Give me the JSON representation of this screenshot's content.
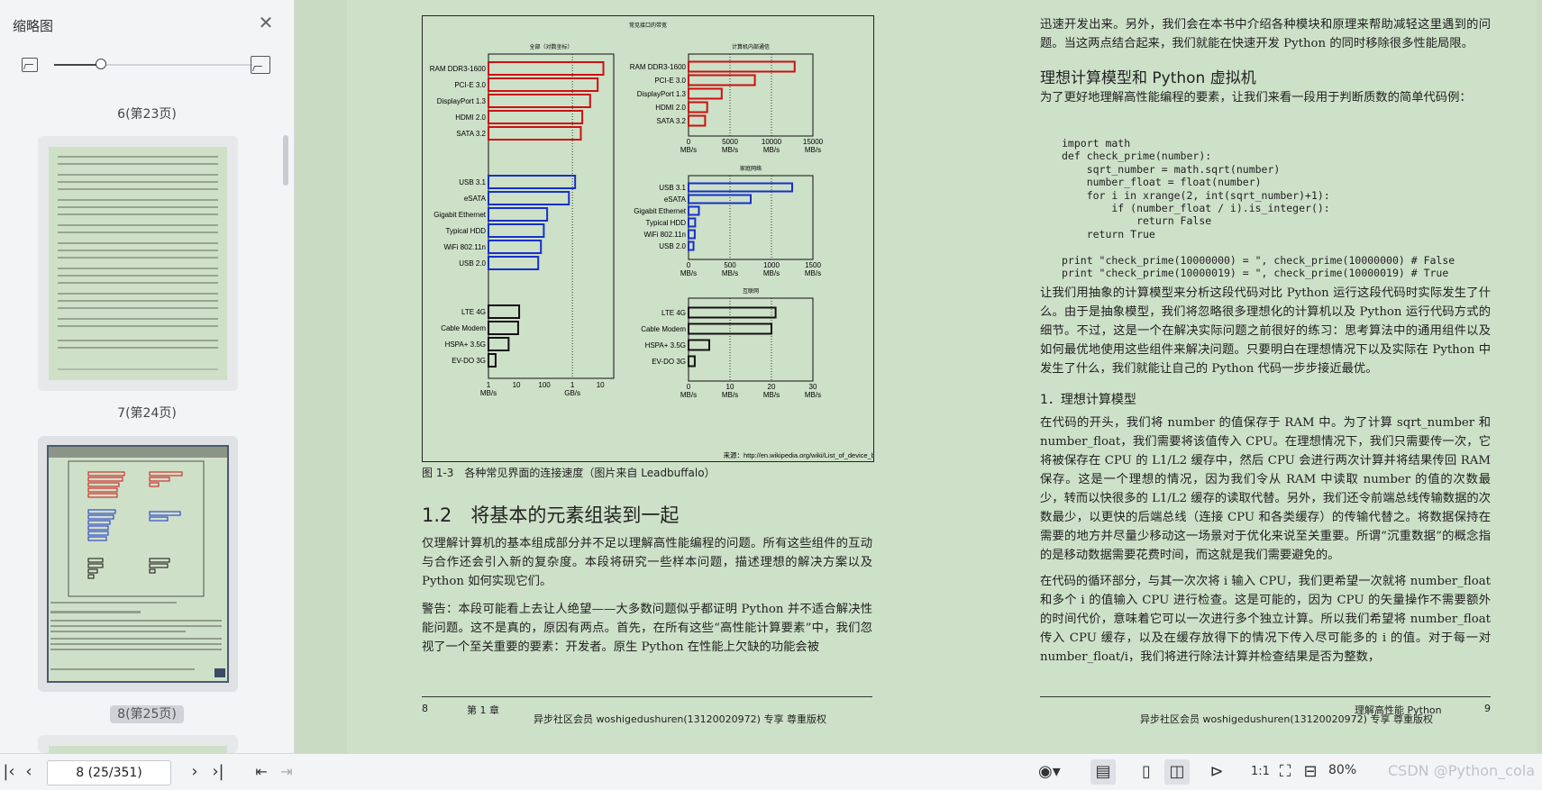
{
  "sidebar": {
    "title": "缩略图",
    "thumbs": [
      {
        "label": "6(第23页)"
      },
      {
        "label": "7(第24页)"
      },
      {
        "label": "8(第25页)"
      }
    ]
  },
  "figure": {
    "caption": "图 1-3　各种常见界面的连接速度（图片来自 Leadbuffalo）",
    "title": "常见接口的带宽",
    "source": "来源：http://en.wikipedia.org/wiki/List_of_device_bit_rates"
  },
  "chart_data": [
    {
      "type": "bar",
      "title": "全部（对数坐标）",
      "categories": [
        "RAM DDR3-1600",
        "PCI-E 3.0",
        "DisplayPort 1.3",
        "HDMI 2.0",
        "SATA 3.2",
        "USB 3.1",
        "eSATA",
        "Gigabit Ethernet",
        "Typical HDD",
        "WiFi 802.11n",
        "USB 2.0",
        "LTE 4G",
        "Cable Modem",
        "HSPA+ 3.5G",
        "EV-DO 3G"
      ],
      "values_mbs": [
        12800,
        8000,
        4300,
        2250,
        2000,
        1250,
        750,
        125,
        95,
        75,
        60,
        12.5,
        11.5,
        5.25,
        1.8
      ],
      "series_colors": [
        "#cc1111",
        "#cc1111",
        "#cc1111",
        "#cc1111",
        "#cc1111",
        "#1730c8",
        "#1730c8",
        "#1730c8",
        "#1730c8",
        "#1730c8",
        "#1730c8",
        "#111111",
        "#111111",
        "#111111",
        "#111111"
      ],
      "log_scale": true,
      "ticks": [
        "1",
        "10",
        "100",
        "1",
        "10"
      ],
      "tick_units": [
        "MB/s",
        "GB/s"
      ]
    },
    {
      "type": "bar",
      "title": "计算机内部通信",
      "categories": [
        "RAM DDR3-1600",
        "PCI-E 3.0",
        "DisplayPort 1.3",
        "HDMI 2.0",
        "SATA 3.2"
      ],
      "values": [
        12800,
        8000,
        4000,
        2250,
        2000
      ],
      "xlim": [
        0,
        15000
      ],
      "ticks": [
        "0",
        "5000",
        "10000",
        "15000"
      ],
      "xlabel": "MB/s"
    },
    {
      "type": "bar",
      "title": "家庭网络",
      "categories": [
        "USB 3.1",
        "eSATA",
        "Gigabit Ethernet",
        "Typical HDD",
        "WiFi 802.11n",
        "USB 2.0"
      ],
      "values": [
        1250,
        750,
        125,
        80,
        75,
        60
      ],
      "xlim": [
        0,
        1500
      ],
      "ticks": [
        "0",
        "500",
        "1000",
        "1500"
      ],
      "xlabel": "MB/s"
    },
    {
      "type": "bar",
      "title": "互联网",
      "categories": [
        "LTE 4G",
        "Cable Modem",
        "HSPA+ 3.5G",
        "EV-DO 3G"
      ],
      "values": [
        21,
        20,
        5,
        1.5
      ],
      "xlim": [
        0,
        30
      ],
      "ticks": [
        "0",
        "10",
        "20",
        "30"
      ],
      "xlabel": "MB/s"
    }
  ],
  "left_page": {
    "section_title": "1.2　将基本的元素组装到一起",
    "para1": "仅理解计算机的基本组成部分并不足以理解高性能编程的问题。所有这些组件的互动与合作还会引入新的复杂度。本段将研究一些样本问题，描述理想的解决方案以及 Python 如何实现它们。",
    "para2": "警告：本段可能看上去让人绝望——大多数问题似乎都证明 Python 并不适合解决性能问题。这不是真的，原因有两点。首先，在所有这些“高性能计算要素”中，我们忽视了一个至关重要的要素：开发者。原生 Python 在性能上欠缺的功能会被",
    "footer_page": "8",
    "footer_chapter": "第 1 章",
    "footer_owner": "异步社区会员 woshigedushuren(13120020972) 专享 尊重版权"
  },
  "right_page": {
    "para_top": "迅速开发出来。另外，我们会在本书中介绍各种模块和原理来帮助减轻这里遇到的问题。当这两点结合起来，我们就能在快速开发 Python 的同时移除很多性能局限。",
    "heading": "理想计算模型和 Python 虚拟机",
    "para_intro": "为了更好地理解高性能编程的要素，让我们来看一段用于判断质数的简单代码例：",
    "code_lines": [
      "import math",
      "def check_prime(number):",
      "    sqrt_number = math.sqrt(number)",
      "    number_float = float(number)",
      "    for i in xrange(2, int(sqrt_number)+1):",
      "        if (number_float / i).is_integer():",
      "            return False",
      "    return True",
      "",
      "print \"check_prime(10000000) = \", check_prime(10000000) # False",
      "print \"check_prime(10000019) = \", check_prime(10000019) # True"
    ],
    "para_model": "让我们用抽象的计算模型来分析这段代码对比 Python 运行这段代码时实际发生了什么。由于是抽象模型，我们将忽略很多理想化的计算机以及 Python 运行代码方式的细节。不过，这是一个在解决实际问题之前很好的练习：思考算法中的通用组件以及如何最优地使用这些组件来解决问题。只要明白在理想情况下以及实际在 Python 中发生了什么，我们就能让自己的 Python 代码一步步接近最优。",
    "subheading": "1．理想计算模型",
    "para_ideal": "在代码的开头，我们将 number 的值保存于 RAM 中。为了计算 sqrt_number 和 number_float，我们需要将该值传入 CPU。在理想情况下，我们只需要传一次，它将被保存在 CPU 的 L1/L2 缓存中，然后 CPU 会进行两次计算并将结果传回 RAM 保存。这是一个理想的情况，因为我们令从 RAM 中读取 number 的值的次数最少，转而以快很多的 L1/L2 缓存的读取代替。另外，我们还令前端总线传输数据的次数最少，以更快的后端总线（连接 CPU 和各类缓存）的传输代替之。将数据保持在需要的地方并尽量少移动这一场景对于优化来说至关重要。所谓“沉重数据”的概念指的是移动数据需要花费时间，而这就是我们需要避免的。",
    "para_loop": "在代码的循环部分，与其一次次将 i 输入 CPU，我们更希望一次就将 number_float 和多个 i 的值输入 CPU 进行检查。这是可能的，因为 CPU 的矢量操作不需要额外的时间代价，意味着它可以一次进行多个独立计算。所以我们希望将 number_float 传入 CPU 缓存，以及在缓存放得下的情况下传入尽可能多的 i 的值。对于每一对 number_float/i，我们将进行除法计算并检查结果是否为整数，",
    "footer_book": "理解高性能 Python",
    "footer_page": "9",
    "footer_owner": "异步社区会员 woshigedushuren(13120020972) 专享 尊重版权"
  },
  "toolbar": {
    "page_value": "8 (25/351)",
    "zoom": "80%",
    "watermark": "CSDN @Python_cola"
  }
}
